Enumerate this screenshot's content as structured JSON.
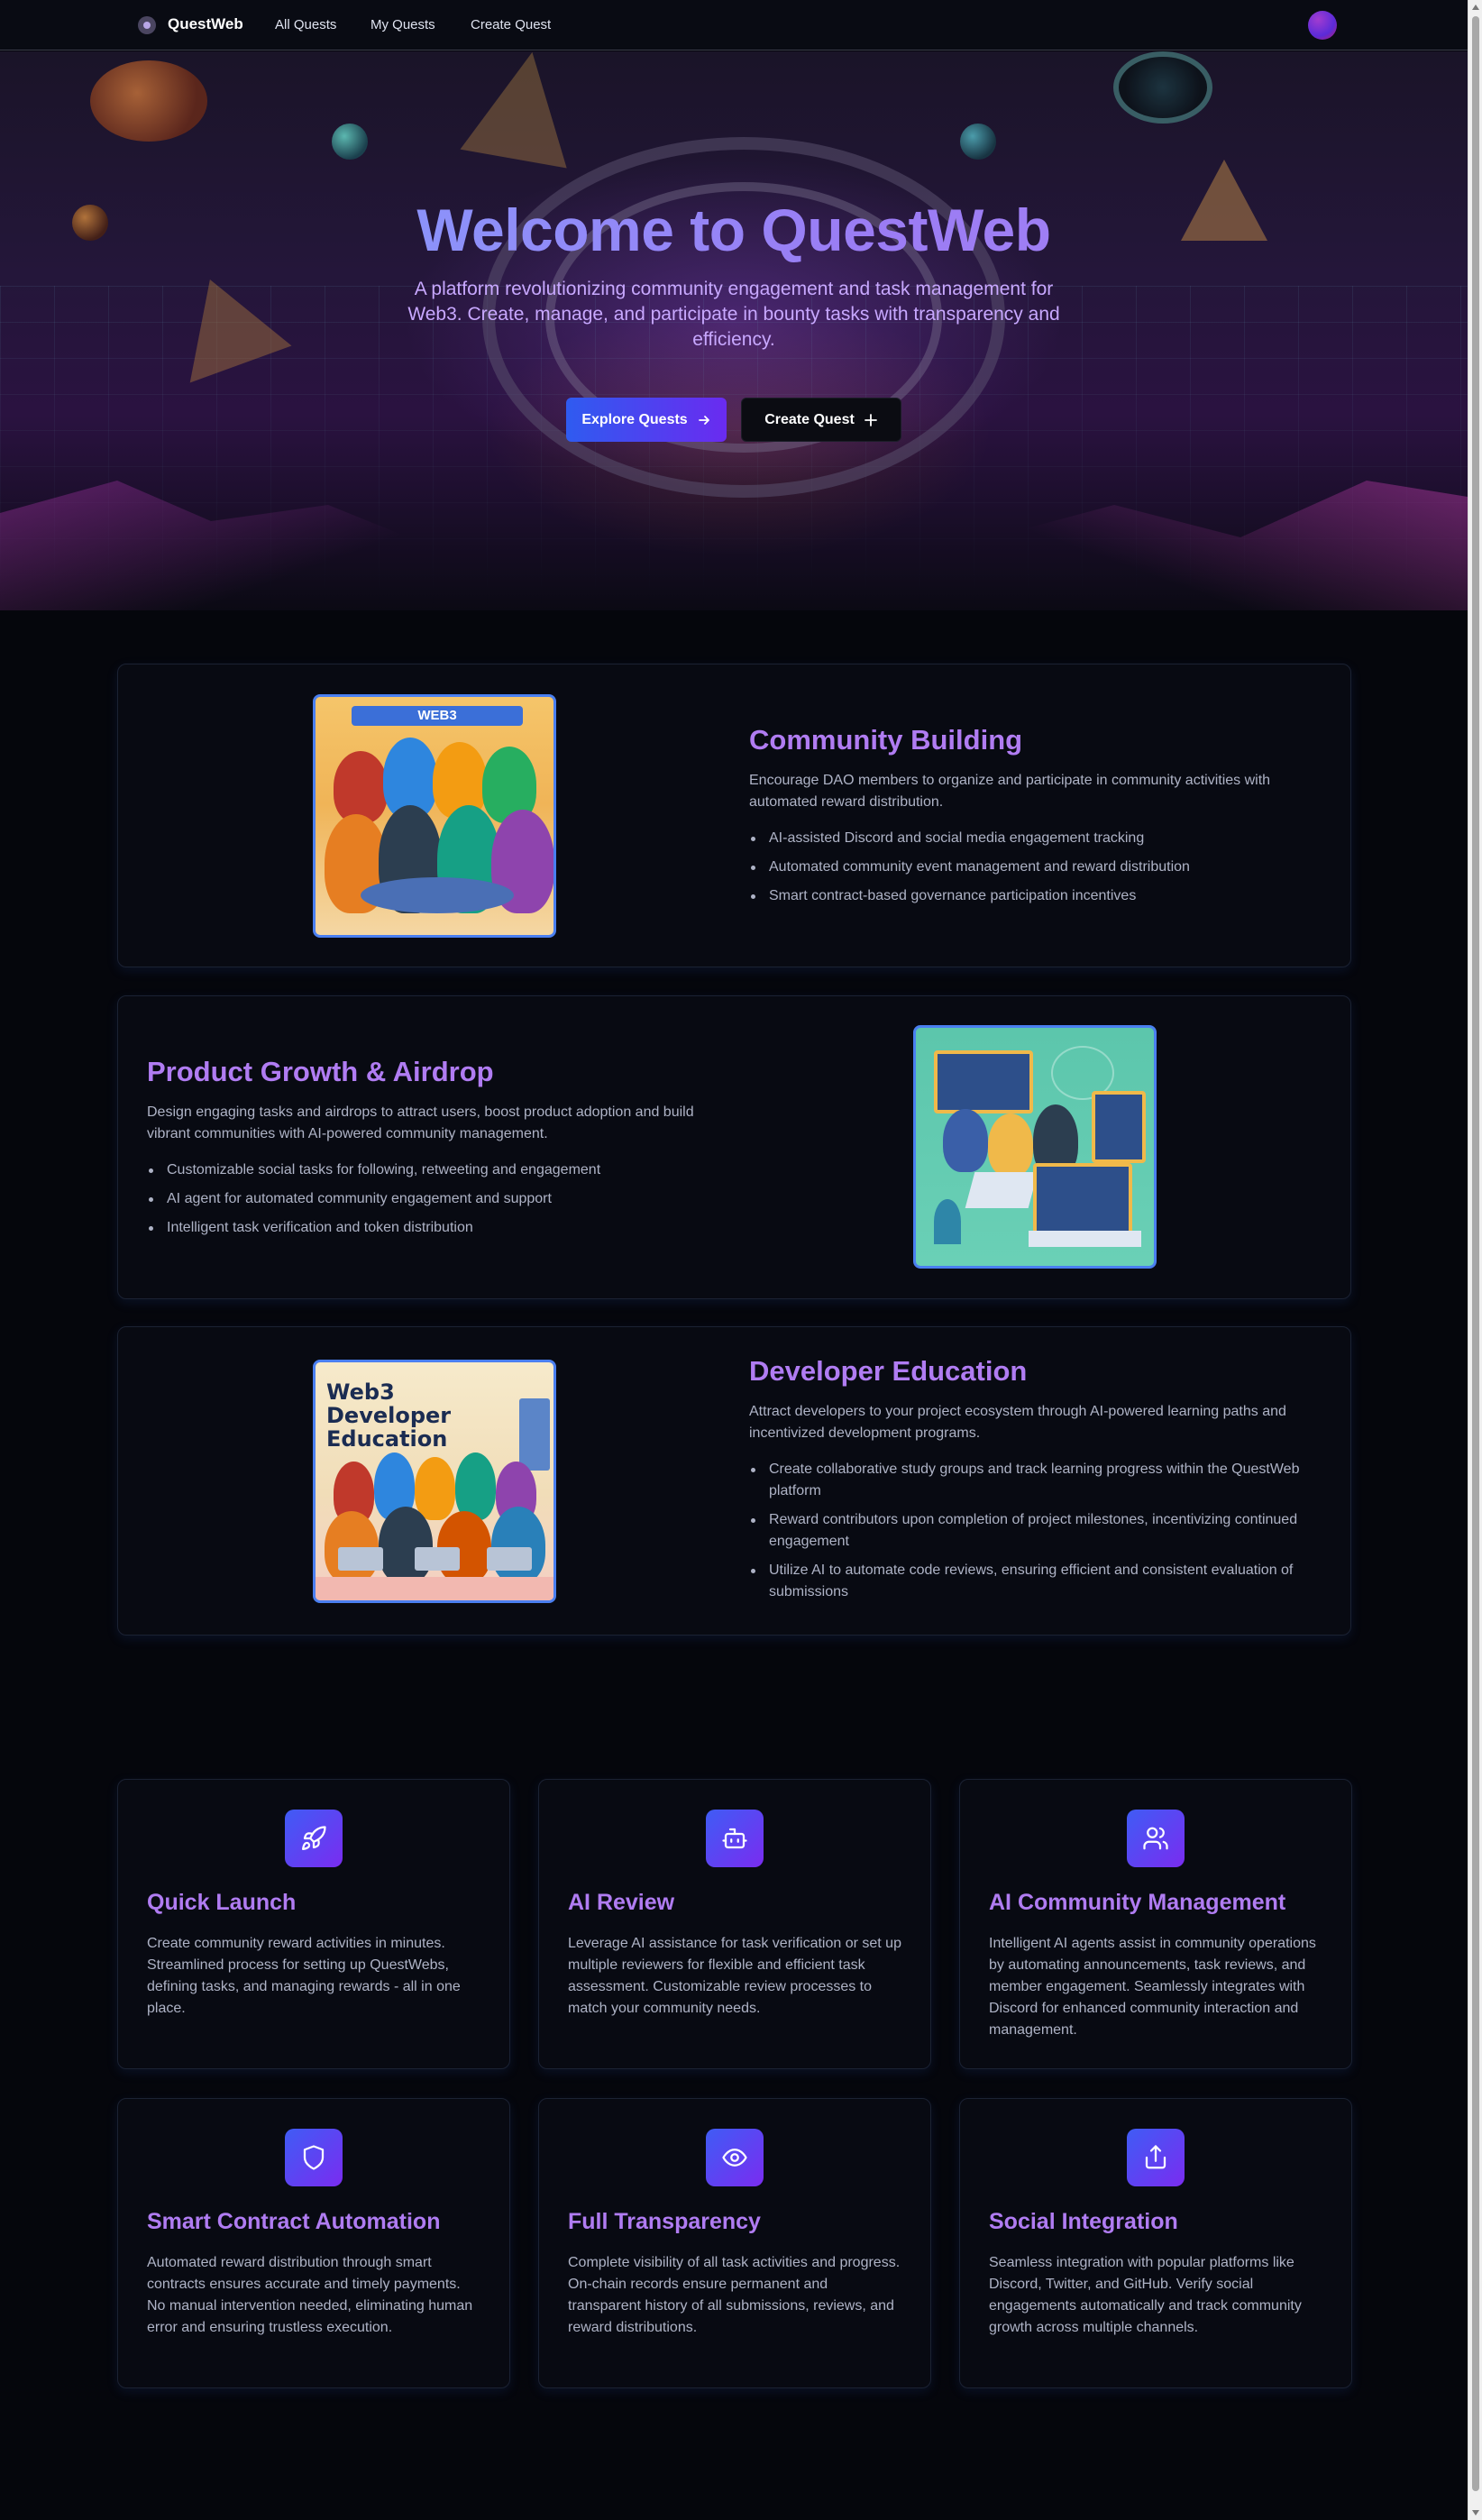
{
  "nav": {
    "brand": "QuestWeb",
    "links": [
      "All Quests",
      "My Quests",
      "Create Quest"
    ]
  },
  "hero": {
    "title": "Welcome to QuestWeb",
    "subtitle": "A platform revolutionizing community engagement and task management for Web3. Create, manage, and participate in bounty tasks with transparency and efficiency.",
    "primary_button": "Explore Quests",
    "secondary_button": "Create Quest"
  },
  "features": [
    {
      "title": "Community Building",
      "description": "Encourage DAO members to organize and participate in community activities with automated reward distribution.",
      "bullets": [
        "AI-assisted Discord and social media engagement tracking",
        "Automated community event management and reward distribution",
        "Smart contract-based governance participation incentives"
      ],
      "image_text": "WEB3"
    },
    {
      "title": "Product Growth & Airdrop",
      "description": "Design engaging tasks and airdrops to attract users, boost product adoption and build vibrant communities with AI-powered community management.",
      "bullets": [
        "Customizable social tasks for following, retweeting and engagement",
        "AI agent for automated community engagement and support",
        "Intelligent task verification and token distribution"
      ]
    },
    {
      "title": "Developer Education",
      "description": "Attract developers to your project ecosystem through AI-powered learning paths and incentivized development programs.",
      "bullets": [
        "Create collaborative study groups and track learning progress within the QuestWeb platform",
        "Reward contributors upon completion of project milestones, incentivizing continued engagement",
        "Utilize AI to automate code reviews, ensuring efficient and consistent evaluation of submissions"
      ],
      "image_text": "Web3 Developer Education"
    }
  ],
  "cards": [
    {
      "icon": "rocket-icon",
      "title": "Quick Launch",
      "text": "Create community reward activities in minutes. Streamlined process for setting up QuestWebs, defining tasks, and managing rewards - all in one place."
    },
    {
      "icon": "robot-icon",
      "title": "AI Review",
      "text": "Leverage AI assistance for task verification or set up multiple reviewers for flexible and efficient task assessment. Customizable review processes to match your community needs."
    },
    {
      "icon": "users-icon",
      "title": "AI Community Management",
      "text": "Intelligent AI agents assist in community operations by automating announcements, task reviews, and member engagement. Seamlessly integrates with Discord for enhanced community interaction and management."
    },
    {
      "icon": "shield-icon",
      "title": "Smart Contract Automation",
      "text": "Automated reward distribution through smart contracts ensures accurate and timely payments. No manual intervention needed, eliminating human error and ensuring trustless execution."
    },
    {
      "icon": "eye-icon",
      "title": "Full Transparency",
      "text": "Complete visibility of all task activities and progress. On-chain records ensure permanent and transparent history of all submissions, reviews, and reward distributions."
    },
    {
      "icon": "share-icon",
      "title": "Social Integration",
      "text": "Seamless integration with popular platforms like Discord, Twitter, and GitHub. Verify social engagements automatically and track community growth across multiple channels."
    }
  ],
  "colors": {
    "accent_purple": "#b07cf2",
    "button_gradient_start": "#2f5bf0",
    "button_gradient_end": "#6a2bf0",
    "background": "#05060c"
  }
}
